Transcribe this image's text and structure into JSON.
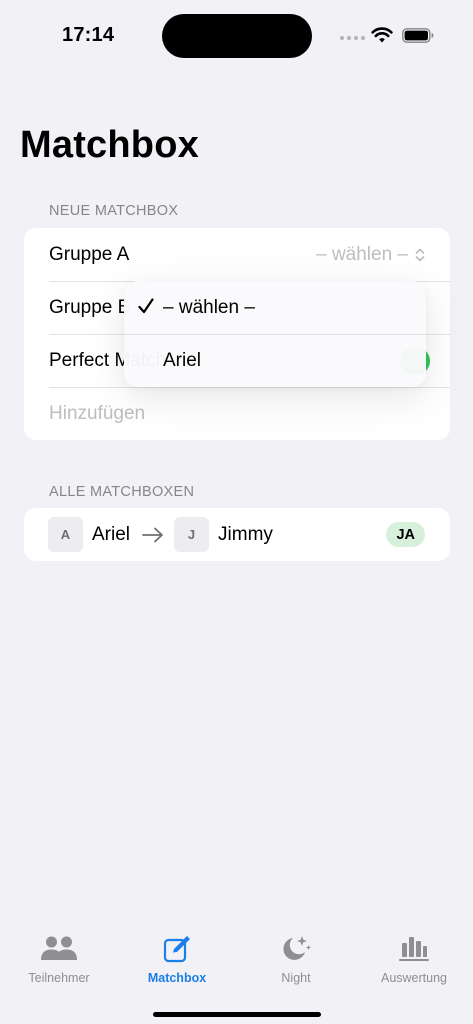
{
  "status_bar": {
    "time": "17:14"
  },
  "page": {
    "title": "Matchbox"
  },
  "new_section": {
    "header": "NEUE MATCHBOX",
    "rows": {
      "group_a": {
        "label": "Gruppe A",
        "value": "– wählen –"
      },
      "group_b": {
        "label": "Gruppe B"
      },
      "perfect": {
        "label": "Perfect Match"
      },
      "add": {
        "label": "Hinzufügen"
      }
    }
  },
  "menu": {
    "items": [
      {
        "label": "– wählen –",
        "selected": true
      },
      {
        "label": "Ariel",
        "selected": false
      }
    ]
  },
  "all_section": {
    "header": "ALLE MATCHBOXEN",
    "rows": [
      {
        "from_initial": "A",
        "from_name": "Ariel",
        "to_initial": "J",
        "to_name": "Jimmy",
        "status": "JA"
      }
    ]
  },
  "tabs": [
    {
      "label": "Teilnehmer",
      "icon": "people-icon",
      "active": false
    },
    {
      "label": "Matchbox",
      "icon": "compose-icon",
      "active": true
    },
    {
      "label": "Night",
      "icon": "moon-stars-icon",
      "active": false
    },
    {
      "label": "Auswertung",
      "icon": "chart-bar-icon",
      "active": false
    }
  ],
  "colors": {
    "accent": "#1A7FE6",
    "background": "#F2F1F6",
    "success_tint": "#D6F0DB",
    "toggle_on": "#34C759"
  }
}
